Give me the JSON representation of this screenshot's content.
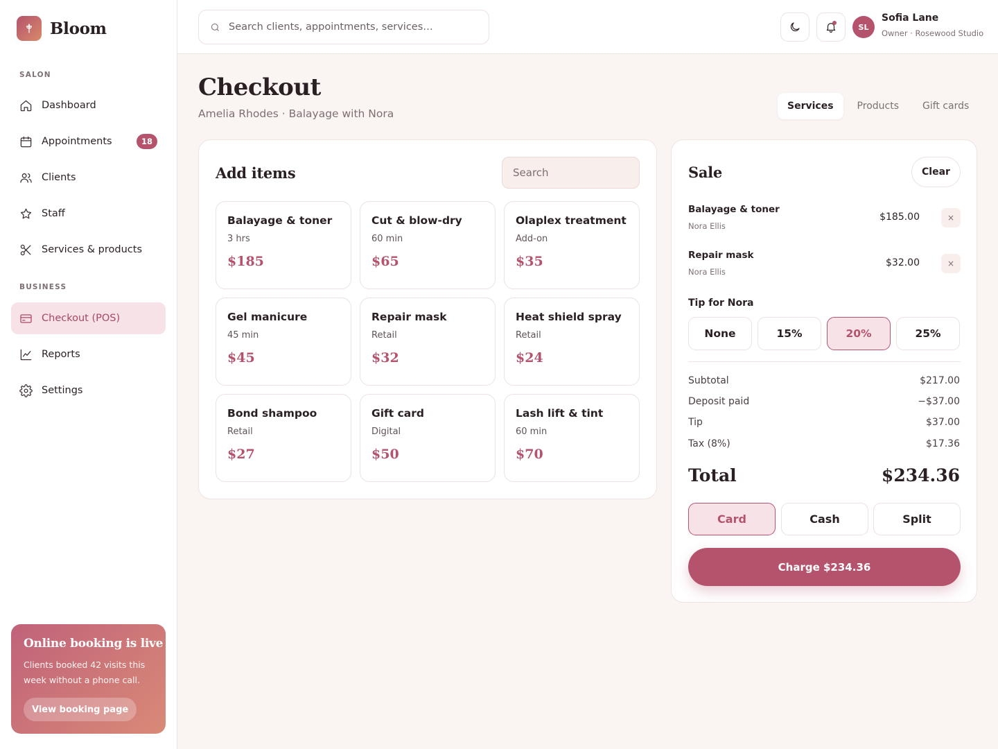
{
  "brand": {
    "name": "Bloom",
    "logo_icon": "flower-icon"
  },
  "sidebar": {
    "sections": [
      {
        "label": "SALON"
      },
      {
        "label": "BUSINESS"
      }
    ],
    "items": [
      {
        "label": "Dashboard",
        "icon": "home-icon"
      },
      {
        "label": "Appointments",
        "icon": "calendar-icon",
        "badge": "18"
      },
      {
        "label": "Clients",
        "icon": "users-icon"
      },
      {
        "label": "Staff",
        "icon": "star-icon"
      },
      {
        "label": "Services & products",
        "icon": "scissors-icon"
      },
      {
        "label": "Checkout (POS)",
        "icon": "credit-card-icon",
        "active": true
      },
      {
        "label": "Reports",
        "icon": "chart-icon"
      },
      {
        "label": "Settings",
        "icon": "gear-icon"
      }
    ],
    "promo": {
      "title": "Online booking is live",
      "text": "Clients booked 42 visits this week without a phone call.",
      "button": "View booking page"
    }
  },
  "topbar": {
    "search_placeholder": "Search clients, appointments, services…",
    "user": {
      "initials": "SL",
      "name": "Sofia Lane",
      "role": "Owner · Rosewood Studio"
    }
  },
  "page": {
    "title": "Checkout",
    "subtitle": "Amelia Rhodes · Balayage with Nora",
    "tabs": [
      {
        "label": "Services",
        "active": true
      },
      {
        "label": "Products"
      },
      {
        "label": "Gift cards"
      }
    ]
  },
  "add_items": {
    "title": "Add items",
    "search_placeholder": "Search",
    "items": [
      {
        "name": "Balayage & toner",
        "meta": "3 hrs",
        "price": "$185"
      },
      {
        "name": "Cut & blow-dry",
        "meta": "60 min",
        "price": "$65"
      },
      {
        "name": "Olaplex treatment",
        "meta": "Add-on",
        "price": "$35"
      },
      {
        "name": "Gel manicure",
        "meta": "45 min",
        "price": "$45"
      },
      {
        "name": "Repair mask",
        "meta": "Retail",
        "price": "$32"
      },
      {
        "name": "Heat shield spray",
        "meta": "Retail",
        "price": "$24"
      },
      {
        "name": "Bond shampoo",
        "meta": "Retail",
        "price": "$27"
      },
      {
        "name": "Gift card",
        "meta": "Digital",
        "price": "$50"
      },
      {
        "name": "Lash lift & tint",
        "meta": "60 min",
        "price": "$70"
      }
    ]
  },
  "sale": {
    "title": "Sale",
    "clear_label": "Clear",
    "lines": [
      {
        "name": "Balayage & toner",
        "staff": "Nora Ellis",
        "price": "$185.00"
      },
      {
        "name": "Repair mask",
        "staff": "Nora Ellis",
        "price": "$32.00"
      }
    ],
    "remove_glyph": "×",
    "tip_label": "Tip for Nora",
    "tip_options": [
      {
        "label": "None"
      },
      {
        "label": "15%"
      },
      {
        "label": "20%",
        "active": true
      },
      {
        "label": "25%"
      }
    ],
    "summary": [
      {
        "label": "Subtotal",
        "value": "$217.00"
      },
      {
        "label": "Deposit paid",
        "value": "−$37.00"
      },
      {
        "label": "Tip",
        "value": "$37.00"
      },
      {
        "label": "Tax (8%)",
        "value": "$17.36"
      }
    ],
    "total_label": "Total",
    "total_value": "$234.36",
    "payment_methods": [
      {
        "label": "Card",
        "active": true
      },
      {
        "label": "Cash"
      },
      {
        "label": "Split"
      }
    ],
    "charge_label": "Charge $234.36"
  },
  "colors": {
    "accent": "#b5536d",
    "accent_soft": "#f7e3e7",
    "background": "#faf5f3",
    "text": "#2a1f22",
    "muted": "#7d6f72"
  }
}
